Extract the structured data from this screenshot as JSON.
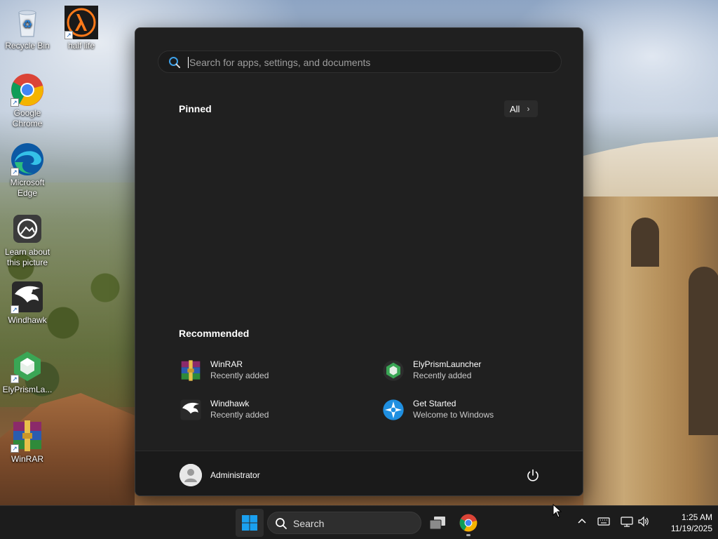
{
  "desktop": {
    "icons": [
      {
        "label": "Recycle Bin"
      },
      {
        "label": "half life"
      },
      {
        "label": "Google Chrome"
      },
      {
        "label": "Microsoft Edge"
      },
      {
        "label": "Learn about this picture"
      },
      {
        "label": "Windhawk"
      },
      {
        "label": "ElyPrismLa..."
      },
      {
        "label": "WinRAR"
      }
    ]
  },
  "start_menu": {
    "search_placeholder": "Search for apps, settings, and documents",
    "pinned_title": "Pinned",
    "all_button_label": "All",
    "recommended_title": "Recommended",
    "recommended": [
      {
        "name": "WinRAR",
        "subtitle": "Recently added",
        "icon": "winrar-icon"
      },
      {
        "name": "ElyPrismLauncher",
        "subtitle": "Recently added",
        "icon": "elyprism-icon"
      },
      {
        "name": "Windhawk",
        "subtitle": "Recently added",
        "icon": "windhawk-icon"
      },
      {
        "name": "Get Started",
        "subtitle": "Welcome to Windows",
        "icon": "get-started-icon"
      }
    ],
    "user_name": "Administrator"
  },
  "taskbar": {
    "search_label": "Search",
    "clock_time": "1:25 AM",
    "clock_date": "11/19/2025"
  },
  "colors": {
    "menu_bg": "#202020",
    "taskbar_bg": "#1c1c1c",
    "accent": "#0078d4"
  }
}
